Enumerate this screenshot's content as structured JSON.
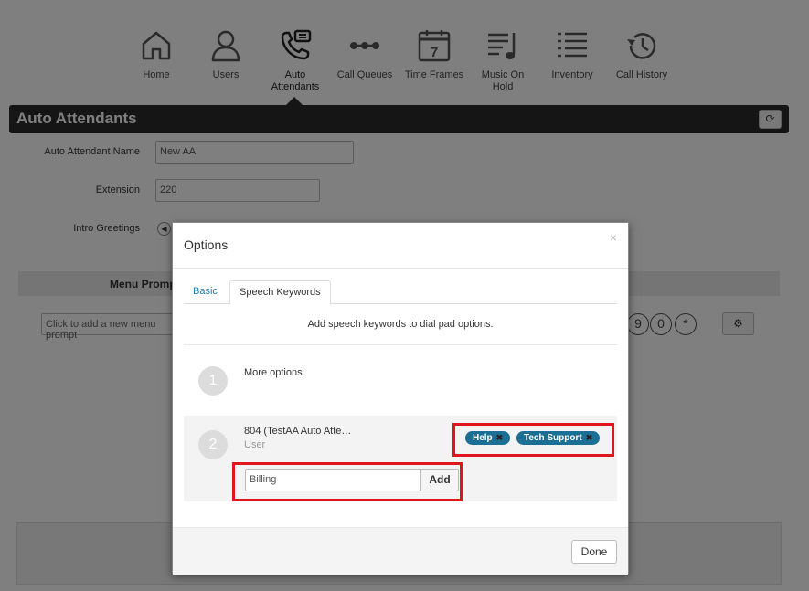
{
  "nav": {
    "items": [
      {
        "label": "Home",
        "icon": "home-icon"
      },
      {
        "label": "Users",
        "icon": "user-icon"
      },
      {
        "label": "Auto Attendants",
        "icon": "auto-attendant-icon"
      },
      {
        "label": "Call Queues",
        "icon": "call-queue-icon"
      },
      {
        "label": "Time Frames",
        "icon": "calendar-icon",
        "badge": "7"
      },
      {
        "label": "Music On Hold",
        "icon": "music-icon"
      },
      {
        "label": "Inventory",
        "icon": "list-icon"
      },
      {
        "label": "Call History",
        "icon": "history-icon"
      }
    ],
    "active": "Auto Attendants"
  },
  "titlebar": {
    "title": "Auto Attendants",
    "refresh_icon": "refresh-icon"
  },
  "form": {
    "name_label": "Auto Attendant Name",
    "name_value": "New AA",
    "extension_label": "Extension",
    "extension_value": "220",
    "greetings_label": "Intro Greetings"
  },
  "menu": {
    "header_label": "Menu Prompt",
    "input_placeholder": "Click to add a new menu prompt",
    "dial_keys": [
      "9",
      "0",
      "*"
    ]
  },
  "modal": {
    "title": "Options",
    "close": "×",
    "tabs": [
      {
        "label": "Basic",
        "active": false
      },
      {
        "label": "Speech Keywords",
        "active": true
      }
    ],
    "hint": "Add speech keywords to dial pad options.",
    "options": [
      {
        "number": "1",
        "label": "More options",
        "sub": ""
      },
      {
        "number": "2",
        "label": "804 (TestAA Auto Atte…",
        "sub": "User"
      }
    ],
    "keywords": [
      "Help",
      "Tech Support"
    ],
    "keyword_input_value": "Billing",
    "add_label": "Add",
    "done_label": "Done"
  },
  "colors": {
    "tag": "#1b6f95",
    "highlight": "#e0161e",
    "titlebar": "#2b2b2b",
    "link": "#1a7bb9"
  }
}
